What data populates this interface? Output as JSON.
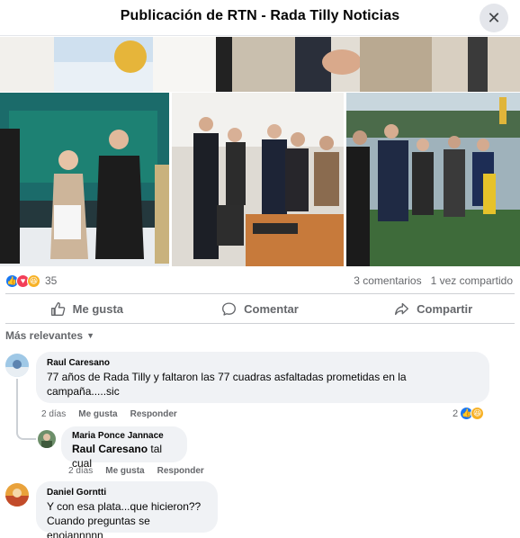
{
  "header": {
    "title": "Publicación de RTN - Rada Tilly Noticias",
    "close_icon": "close-icon"
  },
  "post": {
    "reaction_count": "35",
    "comments_count": "3 comentarios",
    "shares_count": "1 vez compartido"
  },
  "actions": {
    "like": "Me gusta",
    "comment": "Comentar",
    "share": "Compartir"
  },
  "sort_label": "Más relevantes",
  "comments": [
    {
      "author": "Raul Caresano",
      "text": "77 años de Rada Tilly y faltaron las 77 cuadras asfaltadas prometidas en la campaña.....sic",
      "time": "2 días",
      "like": "Me gusta",
      "reply": "Responder",
      "reaction_count": "2"
    },
    {
      "author": "Maria Ponce Jannace",
      "mention": "Raul Caresano",
      "text": "tal cual",
      "time": "2 días",
      "like": "Me gusta",
      "reply": "Responder"
    },
    {
      "author": "Daniel Gorntti",
      "line1": "Y con esa plata...que hicieron??",
      "line2": "Cuando preguntas se enojannnnn"
    }
  ],
  "colors": {
    "like_blue": "#1877f2",
    "love_red": "#f33e58",
    "haha_yellow": "#f7b125",
    "bubble_bg": "#f0f2f5"
  }
}
